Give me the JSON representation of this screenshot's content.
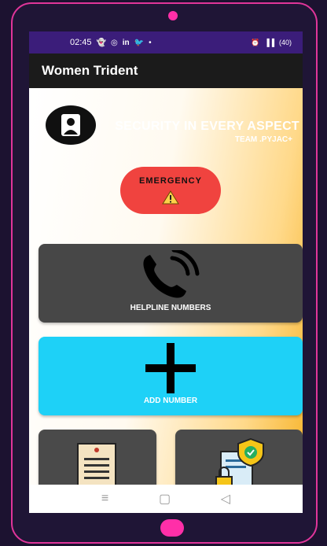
{
  "status_bar": {
    "time": "02:45",
    "indicators": "⏰ ⚡ ⁱᴳ⧉ ▐ ⎕",
    "battery": "(40)"
  },
  "app_bar": {
    "title": "Women Trident"
  },
  "hero": {
    "tagline": "SECURITY IN EVERY ASPECT",
    "team": "TEAM .PYJAC+"
  },
  "emergency": {
    "label": "EMERGENCY"
  },
  "cards": {
    "helpline_label": "HELPLINE NUMBERS",
    "add_number_label": "ADD NUMBER"
  },
  "nav": {
    "recents": "≡",
    "home": "▢",
    "back": "◁"
  },
  "colors": {
    "status_bar": "#3b1d7a",
    "app_bar": "#1b1b1b",
    "emergency": "#f0433f",
    "helpline_card": "#474747",
    "add_number_card": "#1ed1f7",
    "frame": "#e0359a"
  }
}
